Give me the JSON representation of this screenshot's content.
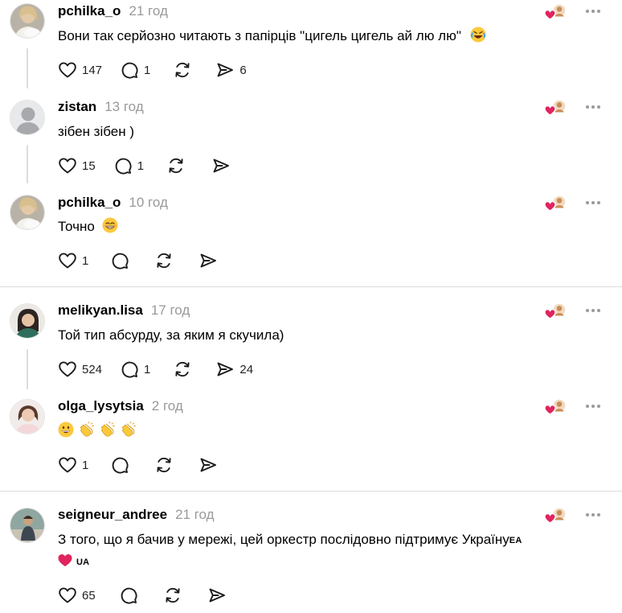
{
  "comments": [
    {
      "username": "pchilka_o",
      "time": "21 год",
      "text": "Вони так серйозно читають з папірців \"цигель цигель ай лю лю\"",
      "emoji": "rolling-on-floor-laughing",
      "likes": "147",
      "replies": "1",
      "reposts": "",
      "shares": "6"
    },
    {
      "username": "zistan",
      "time": "13 год",
      "text": "зібен зібен )",
      "likes": "15",
      "replies": "1",
      "reposts": "",
      "shares": ""
    },
    {
      "username": "pchilka_o",
      "time": "10 год",
      "text": "Точно",
      "emoji": "beaming-face",
      "likes": "1",
      "replies": "",
      "reposts": "",
      "shares": ""
    },
    {
      "username": "melikyan.lisa",
      "time": "17 год",
      "text": "Той тип абсурду, за яким я скучила)",
      "likes": "524",
      "replies": "1",
      "reposts": "",
      "shares": "24"
    },
    {
      "username": "olga_lysytsia",
      "time": "2 год",
      "text": "",
      "emoji_sequence": [
        "grinning-face",
        "clapping-hands",
        "clapping-hands",
        "clapping-hands"
      ],
      "likes": "1",
      "replies": "",
      "reposts": "",
      "shares": ""
    },
    {
      "username": "seigneur_andree",
      "time": "21 год",
      "text": "З того, що я бачив у мережі, цей оркестр послідовно підтримує Україну",
      "flag1": "EA",
      "flag2": "UA",
      "likes": "65",
      "replies": "",
      "reposts": "",
      "shares": ""
    }
  ],
  "icons": {
    "like": "heart-outline-icon",
    "reply": "speech-bubble-icon",
    "repost": "repost-arrows-icon",
    "share": "paper-plane-icon",
    "more": "more-dots-icon",
    "author_liked": "author-liked-heart-icon"
  },
  "colors": {
    "text": "#000000",
    "muted": "#999999",
    "divider": "#dcdcdc",
    "heart_red": "#e0245e",
    "emoji_yellow": "#fbc93c"
  }
}
